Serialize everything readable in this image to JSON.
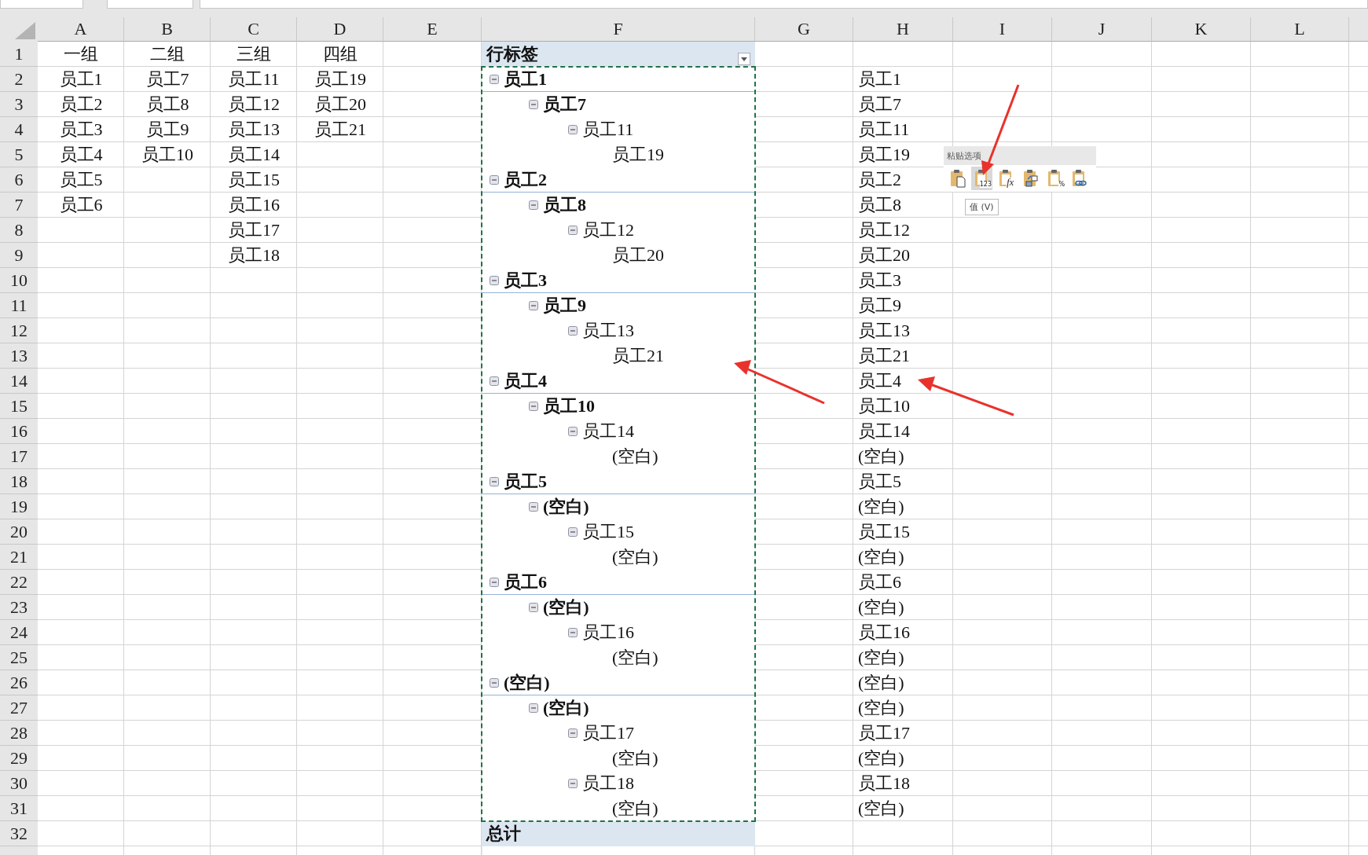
{
  "column_headers": [
    "A",
    "B",
    "C",
    "D",
    "E",
    "F",
    "G",
    "H",
    "I",
    "J",
    "K",
    "L"
  ],
  "row_numbers": [
    "1",
    "2",
    "3",
    "4",
    "5",
    "6",
    "7",
    "8",
    "9",
    "10",
    "11",
    "12",
    "13",
    "14",
    "15",
    "16",
    "17",
    "18",
    "19",
    "20",
    "21",
    "22",
    "23",
    "24",
    "25",
    "26",
    "27",
    "28",
    "29",
    "30",
    "31",
    "32"
  ],
  "groups": {
    "headers": [
      "一组",
      "二组",
      "三组",
      "四组"
    ],
    "columns": [
      [
        "员工1",
        "员工2",
        "员工3",
        "员工4",
        "员工5",
        "员工6"
      ],
      [
        "员工7",
        "员工8",
        "员工9",
        "员工10"
      ],
      [
        "员工11",
        "员工12",
        "员工13",
        "员工14",
        "员工15",
        "员工16",
        "员工17",
        "员工18"
      ],
      [
        "员工19",
        "员工20",
        "员工21"
      ]
    ]
  },
  "pivot": {
    "header": "行标签",
    "total": "总计",
    "tree": [
      {
        "label": "员工1",
        "expanded": true,
        "children": [
          {
            "label": "员工7",
            "expanded": true,
            "children": [
              {
                "label": "员工11",
                "expanded": true,
                "children": [
                  {
                    "label": "员工19"
                  }
                ]
              }
            ]
          }
        ]
      },
      {
        "label": "员工2",
        "expanded": true,
        "children": [
          {
            "label": "员工8",
            "expanded": true,
            "children": [
              {
                "label": "员工12",
                "expanded": true,
                "children": [
                  {
                    "label": "员工20"
                  }
                ]
              }
            ]
          }
        ]
      },
      {
        "label": "员工3",
        "expanded": true,
        "children": [
          {
            "label": "员工9",
            "expanded": true,
            "children": [
              {
                "label": "员工13",
                "expanded": true,
                "children": [
                  {
                    "label": "员工21"
                  }
                ]
              }
            ]
          }
        ]
      },
      {
        "label": "员工4",
        "expanded": true,
        "children": [
          {
            "label": "员工10",
            "expanded": true,
            "children": [
              {
                "label": "员工14",
                "expanded": true,
                "children": [
                  {
                    "label": "(空白)"
                  }
                ]
              }
            ]
          }
        ]
      },
      {
        "label": "员工5",
        "expanded": true,
        "children": [
          {
            "label": "(空白)",
            "expanded": true,
            "children": [
              {
                "label": "员工15",
                "expanded": true,
                "children": [
                  {
                    "label": "(空白)"
                  }
                ]
              }
            ]
          }
        ]
      },
      {
        "label": "员工6",
        "expanded": true,
        "children": [
          {
            "label": "(空白)",
            "expanded": true,
            "children": [
              {
                "label": "员工16",
                "expanded": true,
                "children": [
                  {
                    "label": "(空白)"
                  }
                ]
              }
            ]
          }
        ]
      },
      {
        "label": "(空白)",
        "expanded": true,
        "children": [
          {
            "label": "(空白)",
            "expanded": true,
            "children": [
              {
                "label": "员工17",
                "expanded": true,
                "children": [
                  {
                    "label": "(空白)"
                  }
                ]
              },
              {
                "label": "员工18",
                "expanded": true,
                "children": [
                  {
                    "label": "(空白)"
                  }
                ]
              }
            ]
          }
        ]
      }
    ]
  },
  "column_h": [
    "员工1",
    "员工7",
    "员工11",
    "员工19",
    "员工2",
    "员工8",
    "员工12",
    "员工20",
    "员工3",
    "员工9",
    "员工13",
    "员工21",
    "员工4",
    "员工10",
    "员工14",
    "(空白)",
    "员工5",
    "(空白)",
    "员工15",
    "(空白)",
    "员工6",
    "(空白)",
    "员工16",
    "(空白)",
    "(空白)",
    "(空白)",
    "员工17",
    "(空白)",
    "员工18",
    "(空白)"
  ],
  "paste_options": {
    "title": "粘贴选项",
    "tooltip": "值 (V)",
    "buttons": [
      {
        "kind": "paste",
        "selected": false
      },
      {
        "kind": "values",
        "label": "123",
        "selected": true
      },
      {
        "kind": "formulas",
        "label": "fx",
        "selected": false
      },
      {
        "kind": "transpose",
        "selected": false
      },
      {
        "kind": "formatting",
        "label": "%",
        "selected": false
      },
      {
        "kind": "link",
        "selected": false
      }
    ]
  }
}
